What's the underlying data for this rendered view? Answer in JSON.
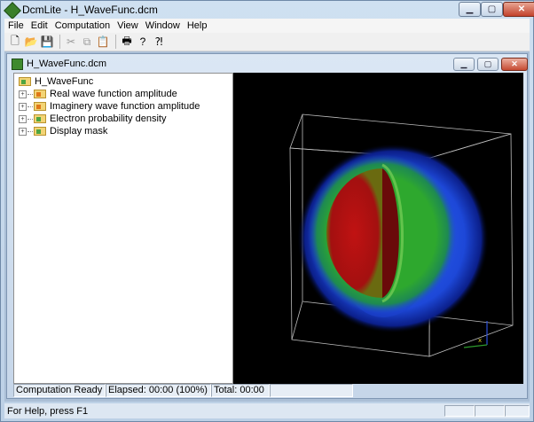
{
  "app": {
    "title": "DcmLite - H_WaveFunc.dcm"
  },
  "menu": [
    "File",
    "Edit",
    "Computation",
    "View",
    "Window",
    "Help"
  ],
  "toolbar": {
    "groups": [
      [
        {
          "name": "new-icon",
          "glyph": "🗋"
        },
        {
          "name": "open-icon",
          "glyph": "📂"
        },
        {
          "name": "save-icon",
          "glyph": "💾"
        }
      ],
      [
        {
          "name": "cut-icon",
          "glyph": "✂"
        },
        {
          "name": "copy-icon",
          "glyph": "⧉"
        },
        {
          "name": "paste-icon",
          "glyph": "📋"
        }
      ],
      [
        {
          "name": "print-icon",
          "glyph": "🖶"
        },
        {
          "name": "about-icon",
          "glyph": "?"
        },
        {
          "name": "context-help-icon",
          "glyph": "⁈"
        }
      ]
    ]
  },
  "child": {
    "title": "H_WaveFunc.dcm"
  },
  "tree": {
    "root": "H_WaveFunc",
    "items": [
      {
        "label": "Real wave function amplitude",
        "icon": "orange"
      },
      {
        "label": "Imaginery wave function amplitude",
        "icon": "orange"
      },
      {
        "label": "Electron probability density",
        "icon": "green"
      },
      {
        "label": "Display mask",
        "icon": "green"
      }
    ]
  },
  "status": {
    "state": "Computation Ready",
    "elapsed": "Elapsed: 00:00 (100%)",
    "total": "Total: 00:00",
    "extra": ""
  },
  "app_status": {
    "help": "For Help, press F1"
  },
  "colors": {
    "viewport_bg": "#000000",
    "core": "#b01010",
    "ring": "#2ea82e",
    "shell": "#1440d8"
  }
}
